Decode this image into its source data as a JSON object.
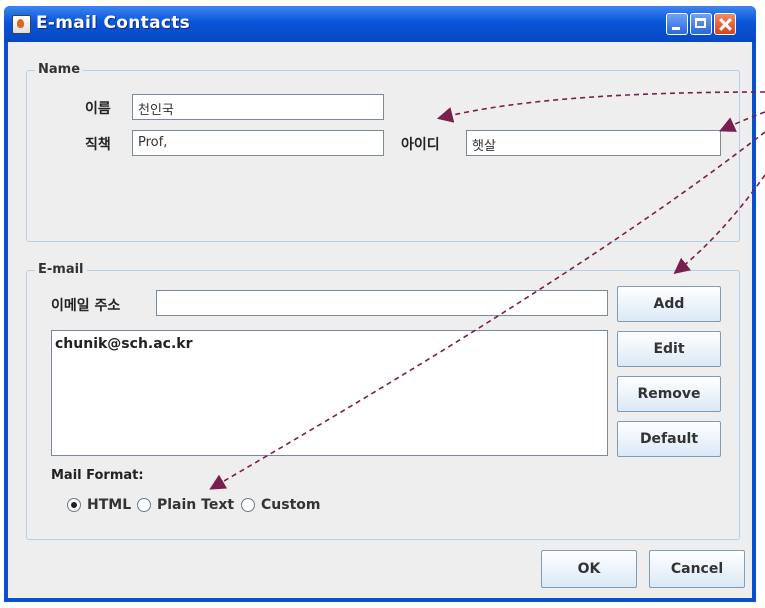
{
  "window": {
    "title": "E-mail Contacts",
    "app_icon": "java-cup-icon",
    "controls": [
      "minimize-icon",
      "maximize-icon",
      "close-icon"
    ]
  },
  "name_group": {
    "title": "Name",
    "name_label": "이름",
    "name_value": "천인국",
    "job_label": "직책",
    "job_value": "Prof,",
    "id_label": "아이디",
    "id_value": "햇살"
  },
  "email_group": {
    "title": "E-mail",
    "address_label": "이메일 주소",
    "address_value": "",
    "list": [
      "chunik@sch.ac.kr"
    ],
    "buttons": {
      "add": "Add",
      "edit": "Edit",
      "remove": "Remove",
      "default": "Default"
    },
    "format_label": "Mail Format:",
    "formats": [
      {
        "label": "HTML",
        "selected": true
      },
      {
        "label": "Plain Text",
        "selected": false
      },
      {
        "label": "Custom",
        "selected": false
      }
    ]
  },
  "footer": {
    "ok": "OK",
    "cancel": "Cancel"
  },
  "colors": {
    "titlebar": "#0a55d9",
    "annotation_arrow": "#7a1e4e"
  }
}
